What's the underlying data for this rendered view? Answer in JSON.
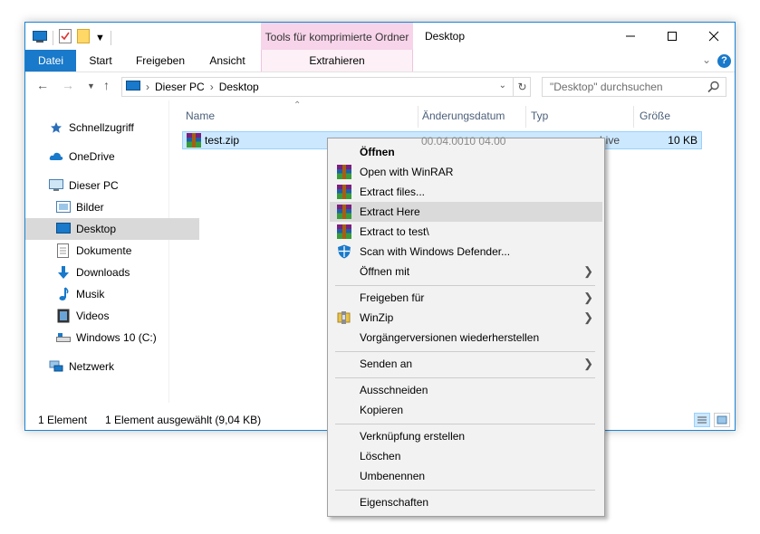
{
  "window": {
    "context_tab_header": "Tools für komprimierte Ordner",
    "title": "Desktop"
  },
  "ribbon": {
    "tabs": [
      "Datei",
      "Start",
      "Freigeben",
      "Ansicht",
      "Extrahieren"
    ]
  },
  "address": {
    "crumbs": [
      "Dieser PC",
      "Desktop"
    ],
    "search_placeholder": "\"Desktop\" durchsuchen"
  },
  "sidebar": {
    "items": [
      {
        "label": "Schnellzugriff",
        "icon": "star-icon"
      },
      {
        "label": "OneDrive",
        "icon": "cloud-icon"
      },
      {
        "label": "Dieser PC",
        "icon": "computer-icon"
      },
      {
        "label": "Bilder",
        "icon": "pictures-icon"
      },
      {
        "label": "Desktop",
        "icon": "desktop-icon",
        "selected": true
      },
      {
        "label": "Dokumente",
        "icon": "documents-icon"
      },
      {
        "label": "Downloads",
        "icon": "download-icon"
      },
      {
        "label": "Musik",
        "icon": "music-icon"
      },
      {
        "label": "Videos",
        "icon": "videos-icon"
      },
      {
        "label": "Windows 10 (C:)",
        "icon": "drive-icon"
      },
      {
        "label": "Netzwerk",
        "icon": "network-icon"
      }
    ]
  },
  "columns": [
    "Name",
    "Änderungsdatum",
    "Typ",
    "Größe"
  ],
  "files": [
    {
      "name": "test.zip",
      "date_partial": "00.04.0010 04.00",
      "type_partial": "hive",
      "size": "10 KB"
    }
  ],
  "status": {
    "count": "1 Element",
    "selected": "1 Element ausgewählt (9,04 KB)"
  },
  "context_menu": {
    "items": [
      {
        "label": "Öffnen",
        "bold": true
      },
      {
        "label": "Open with WinRAR",
        "icon": "winrar-icon"
      },
      {
        "label": "Extract files...",
        "icon": "winrar-icon"
      },
      {
        "label": "Extract Here",
        "icon": "winrar-icon",
        "highlighted": true
      },
      {
        "label": "Extract to test\\",
        "icon": "winrar-icon"
      },
      {
        "label": "Scan with Windows Defender...",
        "icon": "defender-shield-icon"
      },
      {
        "label": "Öffnen mit",
        "submenu": true
      },
      {
        "label": "Freigeben für",
        "submenu": true
      },
      {
        "label": "WinZip",
        "icon": "winzip-icon",
        "submenu": true
      },
      {
        "label": "Vorgängerversionen wiederherstellen"
      },
      {
        "label": "Senden an",
        "submenu": true
      },
      {
        "label": "Ausschneiden"
      },
      {
        "label": "Kopieren"
      },
      {
        "label": "Verknüpfung erstellen"
      },
      {
        "label": "Löschen"
      },
      {
        "label": "Umbenennen"
      },
      {
        "label": "Eigenschaften"
      }
    ]
  },
  "colors": {
    "accent": "#1979ca",
    "selection": "#cce8ff",
    "context_tab": "#f7d4ea"
  }
}
